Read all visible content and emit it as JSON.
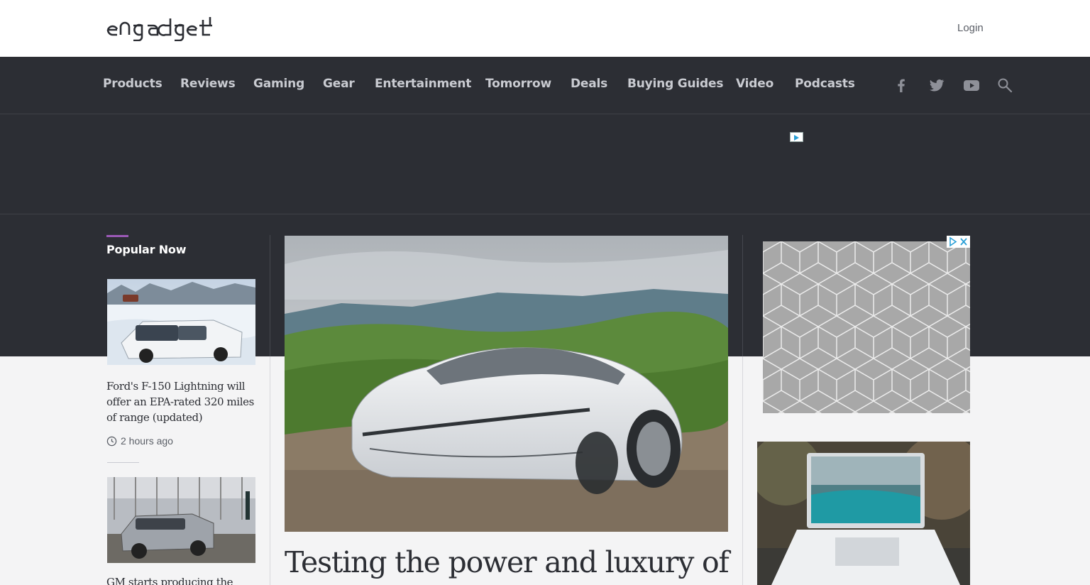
{
  "header": {
    "logo_text": "engadget",
    "login_label": "Login"
  },
  "nav": {
    "items": [
      {
        "label": "Products"
      },
      {
        "label": "Reviews"
      },
      {
        "label": "Gaming"
      },
      {
        "label": "Gear"
      },
      {
        "label": "Entertainment"
      },
      {
        "label": "Tomorrow"
      },
      {
        "label": "Deals"
      },
      {
        "label": "Buying Guides"
      },
      {
        "label": "Video"
      },
      {
        "label": "Podcasts"
      }
    ],
    "icons": [
      "facebook-icon",
      "twitter-icon",
      "youtube-icon",
      "search-icon"
    ]
  },
  "popular": {
    "title": "Popular Now",
    "items": [
      {
        "headline": "Ford's F-150 Lightning will offer an EPA-rated 320 miles of range (updated)",
        "time": "2 hours ago"
      },
      {
        "headline": "GM starts producing the"
      }
    ]
  },
  "hero": {
    "headline": "Testing the power and luxury of"
  },
  "colors": {
    "dark_band": "#2c2e34",
    "accent": "#9b59b6",
    "nav_text": "#c9cbd1"
  }
}
